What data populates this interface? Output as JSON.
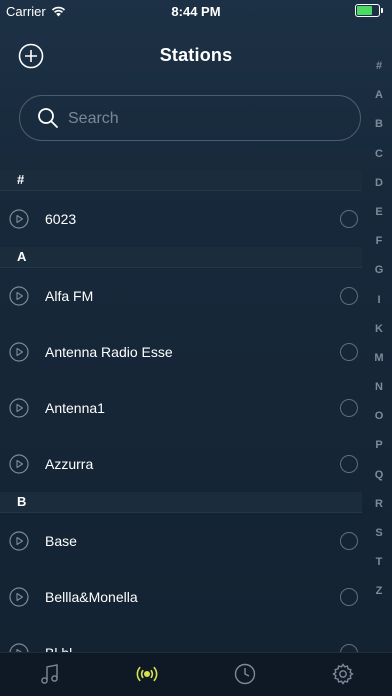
{
  "status": {
    "carrier": "Carrier",
    "time": "8:44 PM"
  },
  "header": {
    "title": "Stations"
  },
  "search": {
    "placeholder": "Search"
  },
  "index_letters": [
    "#",
    "A",
    "B",
    "C",
    "D",
    "E",
    "F",
    "G",
    "I",
    "K",
    "M",
    "N",
    "O",
    "P",
    "Q",
    "R",
    "S",
    "T",
    "Z"
  ],
  "sections": [
    {
      "header": "#",
      "stations": [
        "6023"
      ]
    },
    {
      "header": "A",
      "stations": [
        "Alfa FM",
        "Antenna Radio Esse",
        "Antenna1",
        "Azzurra"
      ]
    },
    {
      "header": "B",
      "stations": [
        "Base",
        "Bellla&Monella",
        "Bl.bl.."
      ]
    }
  ],
  "tabs": [
    {
      "icon": "music-note-icon",
      "active": false
    },
    {
      "icon": "radio-broadcast-icon",
      "active": true
    },
    {
      "icon": "clock-icon",
      "active": false
    },
    {
      "icon": "gear-icon",
      "active": false
    }
  ],
  "colors": {
    "accent": "#d7e34b",
    "background": "#17293b",
    "muted": "#7d8a98"
  }
}
